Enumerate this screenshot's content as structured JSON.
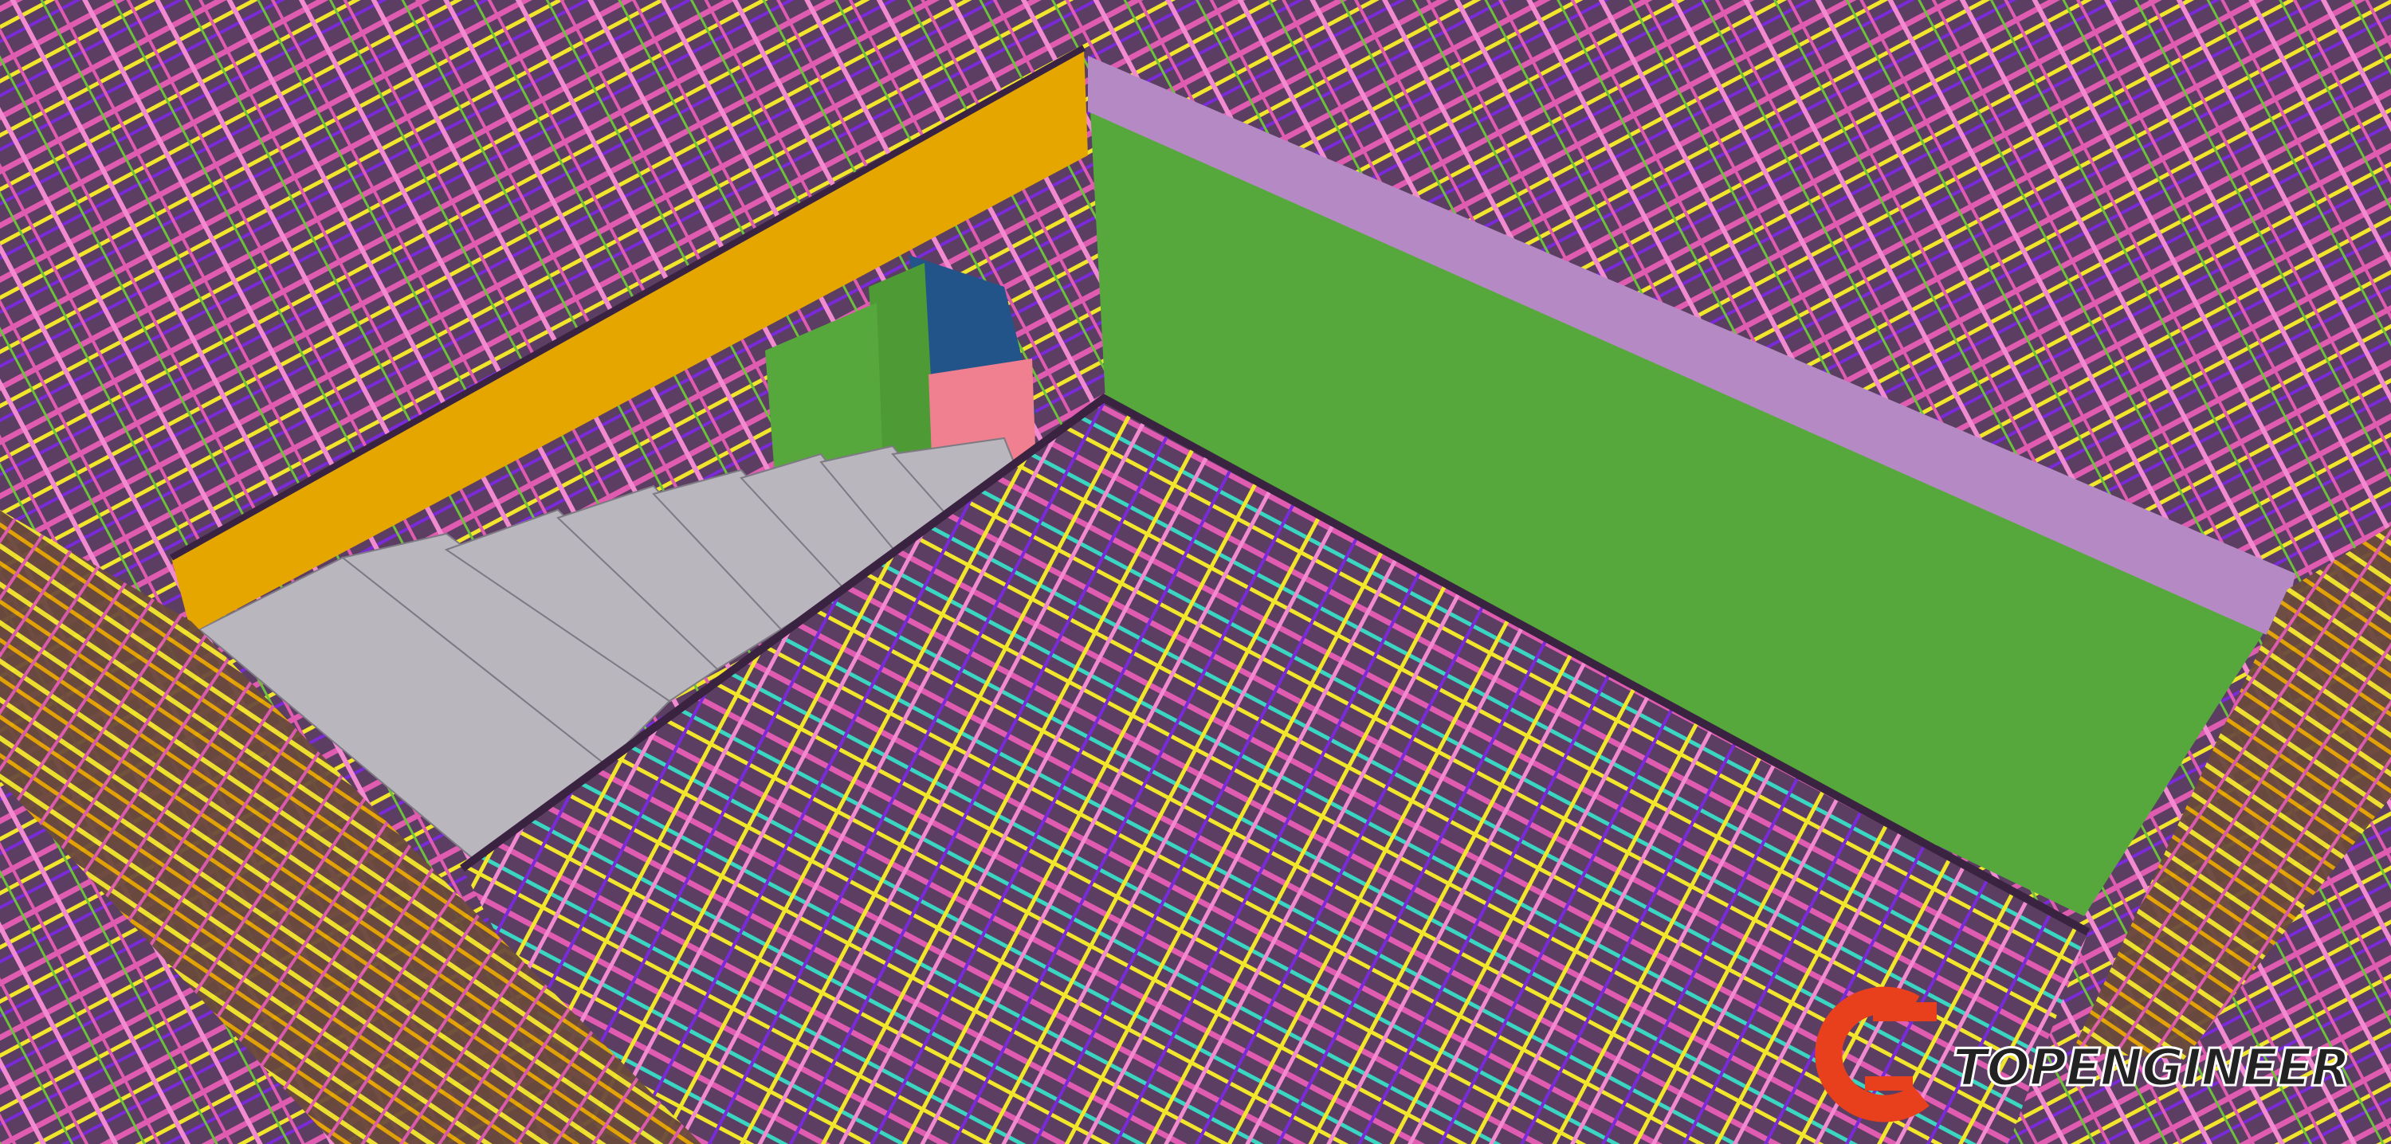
{
  "scene": {
    "description_type": "3d-bim-rebar-render",
    "colors": {
      "background": "#5a3a5e",
      "slab": "#5c3e62",
      "opening_floor": "#57a83c",
      "beam_left": "#e6a600",
      "wall_right": "#b58ac4",
      "wall_dark_blue": "#22548a",
      "wall_green": "#4e9a34",
      "wall_pink": "#f08090",
      "stairs": "#b9b6be",
      "rebar_magenta": "#e05cb0",
      "rebar_yellow": "#f2e62c",
      "rebar_purple": "#7a2ad8",
      "rebar_teal": "#3ad6c2",
      "rebar_green": "#6cc23a",
      "rebar_pink": "#f28ad0",
      "beam_bottom": "#c98a00"
    }
  },
  "logo": {
    "text": "TOPENGINEER",
    "icon": "topengineer-c-logo-icon",
    "colors": {
      "primary": "#e8401c",
      "text_fill": "#222222",
      "text_stroke": "#ffffff"
    }
  }
}
